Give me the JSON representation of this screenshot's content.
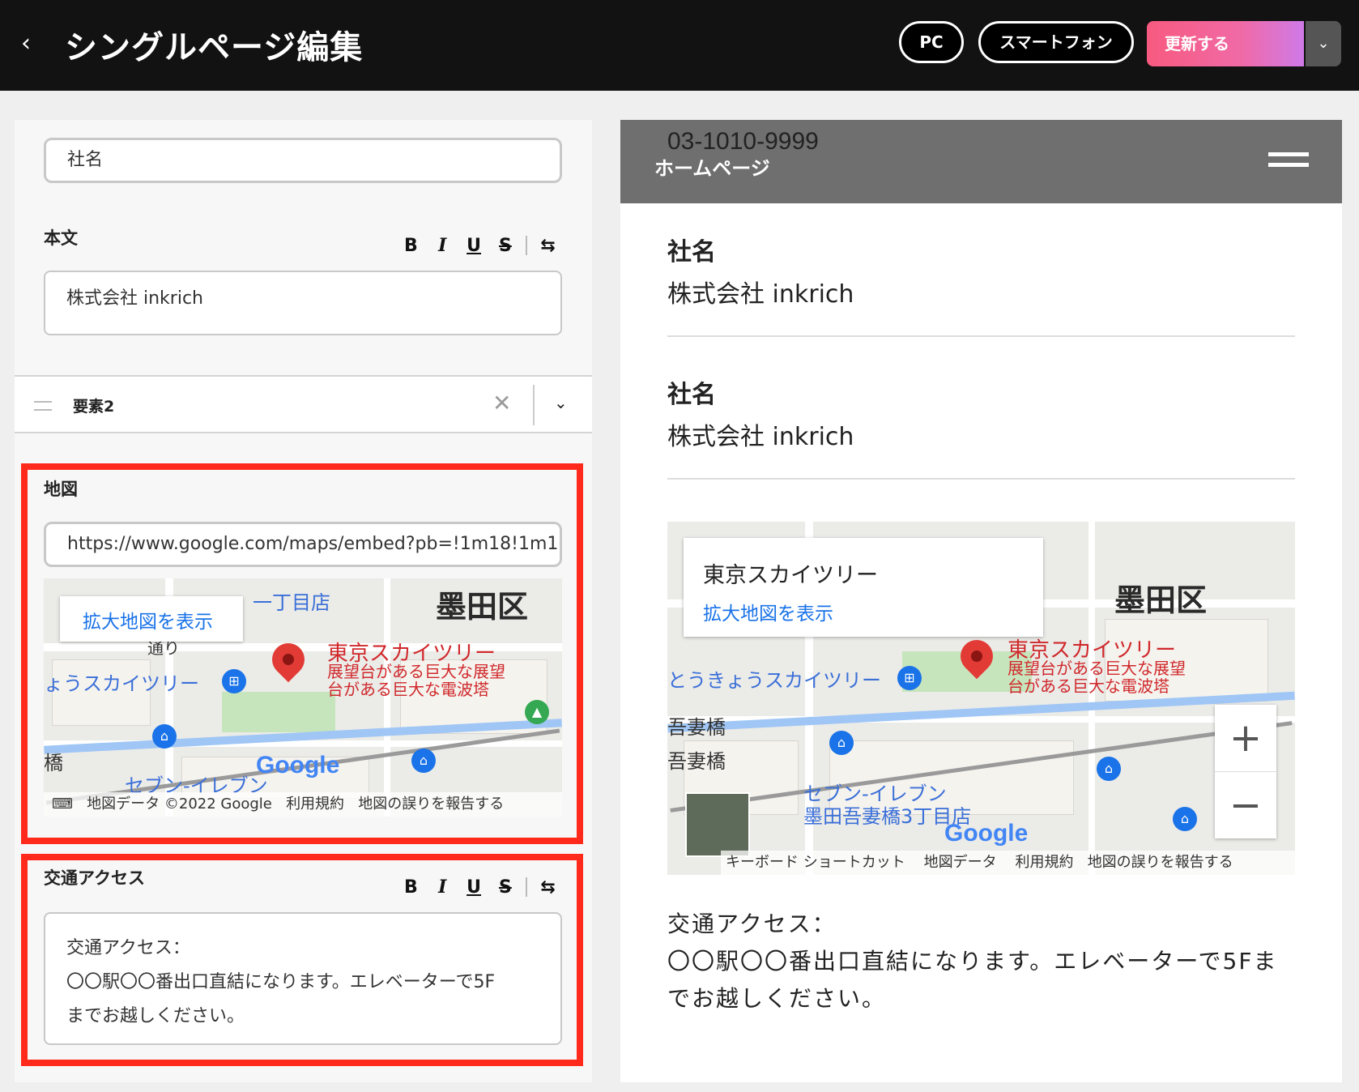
{
  "header": {
    "back_icon": "chevron-left-icon",
    "title": "シングルページ編集",
    "pc_label": "PC",
    "smartphone_label": "スマートフォン",
    "update_label": "更新する",
    "dropdown_icon": "chevron-down-icon",
    "accent_gradient": [
      "#f75a7f",
      "#cf7ae8"
    ]
  },
  "editor": {
    "company_input_value": "社名",
    "body_label": "本文",
    "body_text": "株式会社 inkrich",
    "toolbar": {
      "bold": "B",
      "italic": "I",
      "underline": "U",
      "strike": "S",
      "link_icon": "link-icon"
    },
    "element2_title": "要素2",
    "map_label": "地図",
    "map_url": "https://www.google.com/maps/embed?pb=!1m18!1m1",
    "access_label": "交通アクセス",
    "access_line1": "交通アクセス：",
    "access_line2": "〇〇駅〇〇番出口直結になります。エレベーターで5F",
    "access_line3": "までお越しください。",
    "highlight_color": "#ff2a1c"
  },
  "map_small": {
    "view_larger": "拡大地図を表示",
    "ward": "墨田区",
    "poi_title": "東京スカイツリー",
    "poi_sub1": "展望台がある巨大な展望",
    "poi_sub2": "台がある巨大な電波塔",
    "station": "ょうスカイツリー",
    "store": "セブン-イレブン",
    "top_text": "一丁目店",
    "bridge": "橋",
    "street": "通り",
    "footer_data": "地図データ ©2022 Google",
    "footer_terms": "利用規約",
    "footer_report": "地図の誤りを報告する",
    "google": "Google"
  },
  "preview": {
    "phone": "03-1010-9999",
    "home": "ホームページ",
    "section1_head": "社名",
    "section1_body": "株式会社 inkrich",
    "section2_head": "社名",
    "section2_body": "株式会社 inkrich",
    "map": {
      "place_name": "東京スカイツリー",
      "view_larger": "拡大地図を表示",
      "ward": "墨田区",
      "poi_title": "東京スカイツリー",
      "poi_sub1": "展望台がある巨大な展望",
      "poi_sub2": "台がある巨大な電波塔",
      "station": "とうきょうスカイツリー",
      "bridge1": "吾妻橋",
      "bridge2": "吾妻橋",
      "store1": "セブン-イレブン",
      "store2": "墨田吾妻橋3丁目店",
      "google": "Google",
      "footer_shortcut": "キーボード ショートカット",
      "footer_data": "地図データ",
      "footer_terms": "利用規約",
      "footer_report": "地図の誤りを報告する",
      "zoom_in": "+",
      "zoom_out": "−"
    },
    "access_line1": "交通アクセス：",
    "access_line2": "〇〇駅〇〇番出口直結になります。エレベーターで5Fま",
    "access_line3": "でお越しください。"
  }
}
